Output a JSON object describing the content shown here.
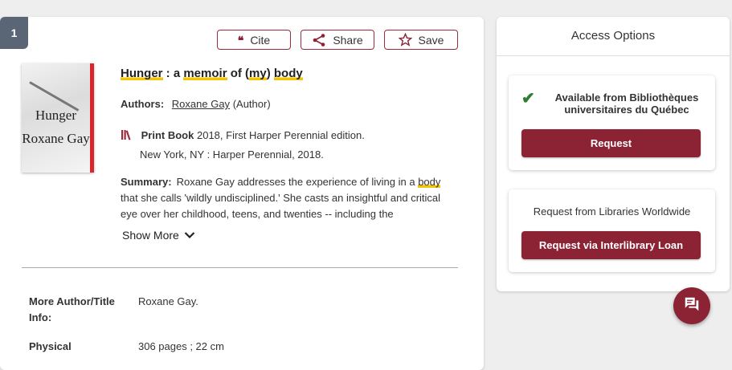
{
  "result": {
    "number": "1",
    "actions": {
      "cite": "Cite",
      "share": "Share",
      "save": "Save"
    },
    "cover": {
      "title": "Hunger",
      "author": "Roxane Gay"
    },
    "title_parts": [
      "Hunger",
      " : a ",
      "memoir",
      " of (",
      "my",
      ") ",
      "body"
    ],
    "authors_label": "Authors:",
    "author_name": "Roxane Gay",
    "author_role": "(Author)",
    "format": "Print Book",
    "edition": "2018, First Harper Perennial edition.",
    "publisher": "New York, NY : Harper Perennial, 2018.",
    "summary_label": "Summary:",
    "summary_parts": [
      "Roxane Gay addresses the experience of living in a ",
      "body",
      " that she calls 'wildly undisciplined.' She casts an insightful and critical eye over her childhood, teens, and twenties -- including the"
    ],
    "show_more": "Show More",
    "details": [
      {
        "label": "More Author/Title Info:",
        "value": "Roxane Gay."
      },
      {
        "label": "Physical",
        "value": "306 pages ; 22 cm"
      }
    ]
  },
  "access": {
    "title": "Access Options",
    "available_text": "Available from Bibliothèques universitaires du Québec",
    "request_label": "Request",
    "worldwide_text": "Request from Libraries Worldwide",
    "ill_label": "Request via Interlibrary Loan"
  },
  "colors": {
    "accent": "#8b2335",
    "highlight": "#f2c500",
    "success": "#2e7d32"
  },
  "icons": {
    "cite": "quote-icon",
    "share": "share-icon",
    "save": "star-icon",
    "format": "book-icon",
    "show_more": "chevron-down-icon",
    "available": "check-icon",
    "chat": "chat-icon"
  }
}
